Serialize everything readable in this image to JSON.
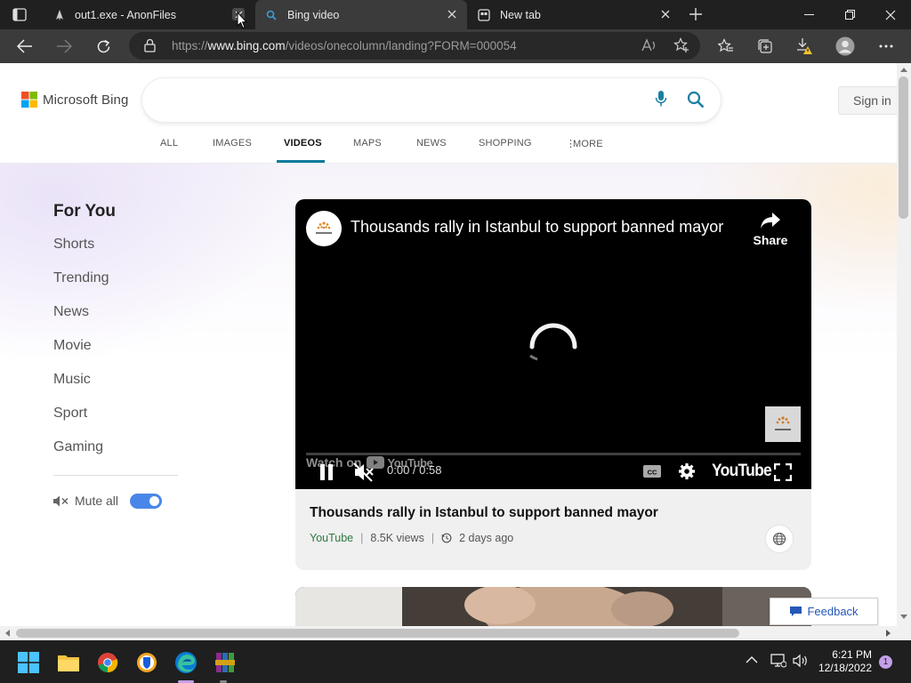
{
  "browser": {
    "tabs": [
      {
        "title": "out1.exe - AnonFiles",
        "icon": "anonfiles-icon"
      },
      {
        "title": "Bing video",
        "icon": "bing-search-icon",
        "active": true
      },
      {
        "title": "New tab",
        "icon": "new-tab-icon"
      }
    ],
    "url_prefix": "https://",
    "url_domain": "www.bing.com",
    "url_path": "/videos/onecolumn/landing?FORM=000054"
  },
  "header": {
    "logo_text": "Microsoft Bing",
    "search_value": "",
    "sign_in": "Sign in"
  },
  "nav": {
    "items": [
      "ALL",
      "IMAGES",
      "VIDEOS",
      "MAPS",
      "NEWS",
      "SHOPPING",
      "MORE"
    ],
    "active": "VIDEOS"
  },
  "sidebar": {
    "heading": "For You",
    "items": [
      "Shorts",
      "Trending",
      "News",
      "Movie",
      "Music",
      "Sport",
      "Gaming"
    ],
    "mute_label": "Mute all",
    "mute_on": true
  },
  "video": {
    "title": "Thousands rally in Istanbul to support banned mayor",
    "share_label": "Share",
    "watch_on": "Watch on",
    "youtube_logo": "YouTube",
    "timecode": "0:00 / 0:58",
    "card_title": "Thousands rally in Istanbul to support banned mayor",
    "source": "YouTube",
    "views": "8.5K views",
    "age": "2 days ago"
  },
  "feedback": "Feedback",
  "taskbar": {
    "apps": [
      "windows-start-icon",
      "file-explorer-icon",
      "chrome-icon",
      "bitwarden-icon",
      "edge-icon",
      "winrar-icon"
    ],
    "time": "6:21 PM",
    "date": "12/18/2022",
    "notifications": "1"
  },
  "colors": {
    "accent_blue": "#4a86e8",
    "nav_active": "#0a7a9c",
    "tab_bar": "#202020",
    "toolbar": "#3b3b3b"
  }
}
